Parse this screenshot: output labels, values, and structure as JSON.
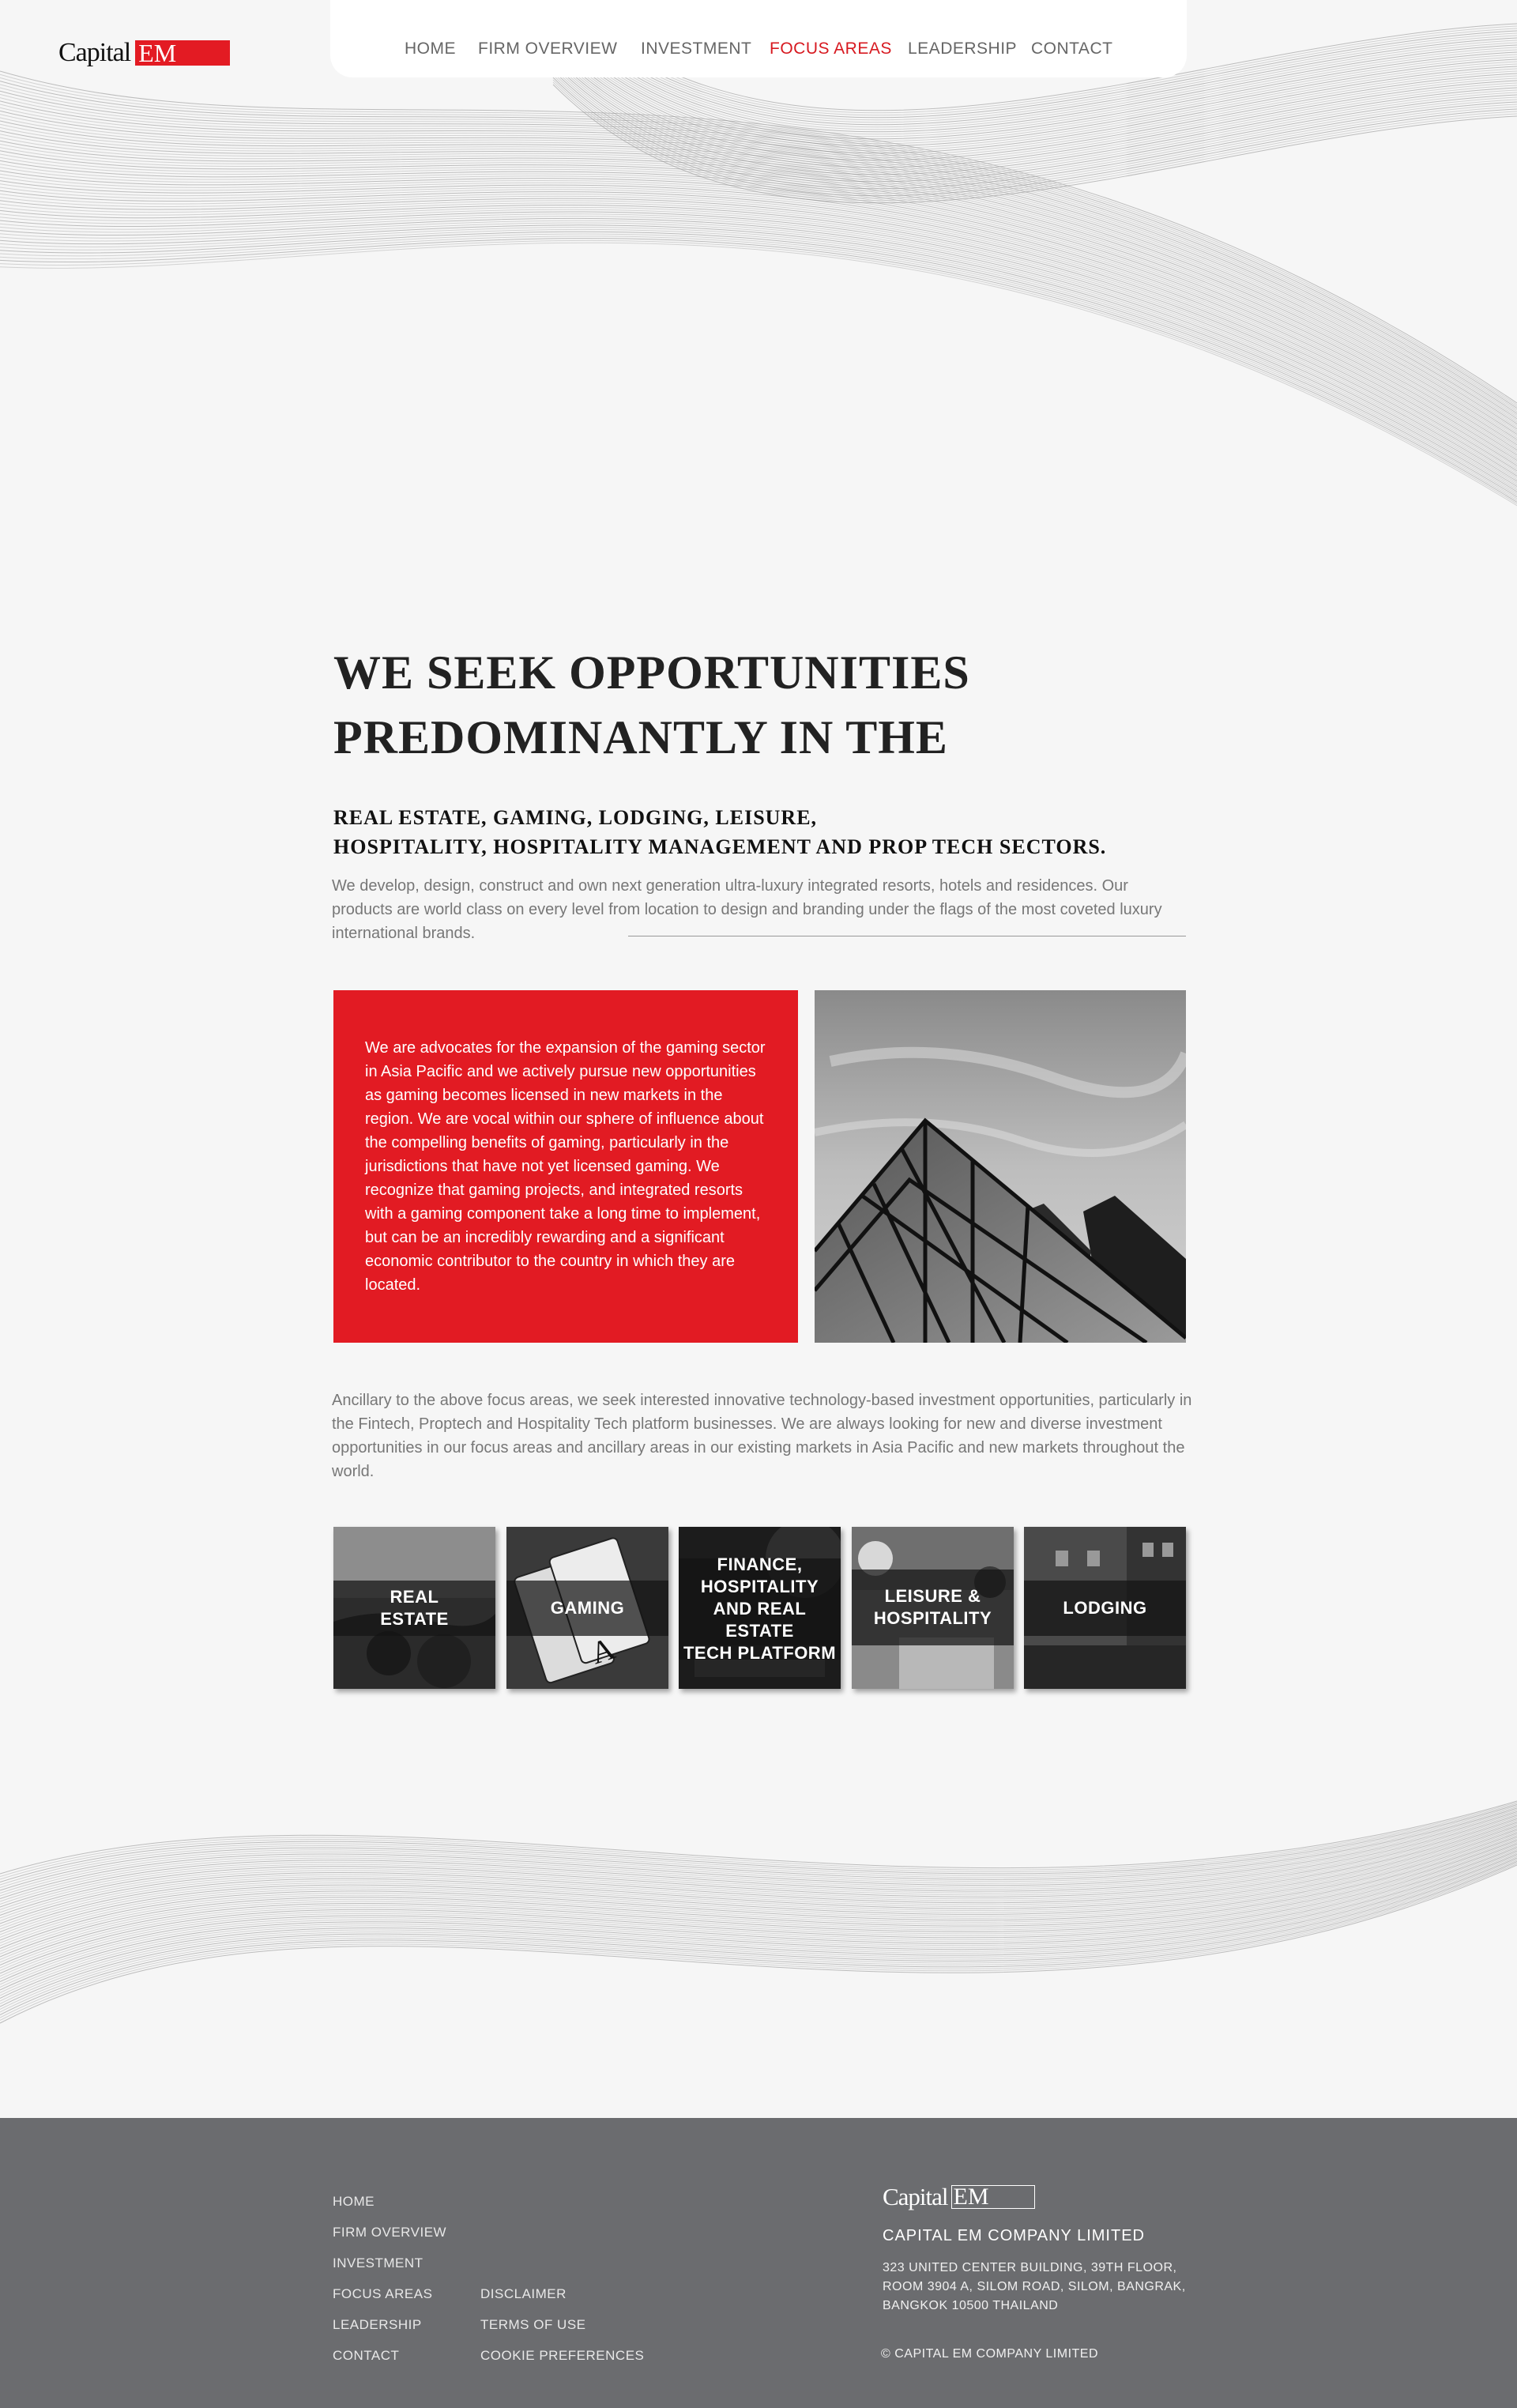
{
  "brand": {
    "logo_word": "Capital",
    "logo_mark": "EM",
    "accent_color": "#e31b23"
  },
  "nav": {
    "items": [
      "HOME",
      "FIRM OVERVIEW",
      "INVESTMENT",
      "FOCUS AREAS",
      "LEADERSHIP",
      "CONTACT"
    ],
    "active": "FOCUS AREAS"
  },
  "hero": {
    "headline_line1": "WE SEEK OPPORTUNITIES",
    "headline_line2": "PREDOMINANTLY IN THE",
    "subhead_line1": "REAL ESTATE, GAMING, LODGING, LEISURE,",
    "subhead_line2": "HOSPITALITY, HOSPITALITY MANAGEMENT AND PROP TECH SECTORS.",
    "intro": "We develop, design, construct and own next generation ultra-luxury integrated resorts, hotels and residences. Our products are world class on every level from location to design and branding under the flags of the most coveted luxury international brands."
  },
  "gaming_box": {
    "text": "We are advocates for the expansion of the gaming sector in Asia Pacific and we actively pursue new opportunities as gaming becomes licensed in new markets in the region. We are vocal within our sphere of influence about the compelling benefits of gaming, particularly in the jurisdictions that have not yet licensed gaming. We recognize that gaming projects, and integrated resorts with a gaming component take a long time to implement, but can be an incredibly rewarding and a significant economic  contributor to the country in which they are located."
  },
  "ancillary": "Ancillary to the above focus areas, we seek interested innovative technology-based investment opportunities, particularly in the Fintech, Proptech and Hospitality Tech platform businesses. We are always looking for new and diverse investment opportunities in our focus areas and ancillary areas in our existing markets in Asia Pacific and new markets throughout the world.",
  "tiles": [
    {
      "label": "REAL\nESTATE"
    },
    {
      "label": "GAMING"
    },
    {
      "label": "FINANCE,\nHOSPITALITY\nAND REAL ESTATE\nTECH PLATFORM"
    },
    {
      "label": "LEISURE  &\nHOSPITALITY"
    },
    {
      "label": "LODGING"
    }
  ],
  "footer": {
    "links_col1": [
      "HOME",
      "FIRM OVERVIEW",
      "INVESTMENT",
      "FOCUS AREAS",
      "LEADERSHIP",
      "CONTACT"
    ],
    "links_col2": [
      "DISCLAIMER",
      "TERMS OF USE",
      "COOKIE PREFERENCES"
    ],
    "company_name": "CAPITAL EM COMPANY LIMITED",
    "address_line1": "323 UNITED CENTER BUILDING, 39TH FLOOR,",
    "address_line2": "ROOM 3904 A, SILOM ROAD, SILOM, BANGRAK,",
    "address_line3": "BANGKOK 10500 THAILAND",
    "copyright": "© CAPITAL EM COMPANY LIMITED"
  }
}
